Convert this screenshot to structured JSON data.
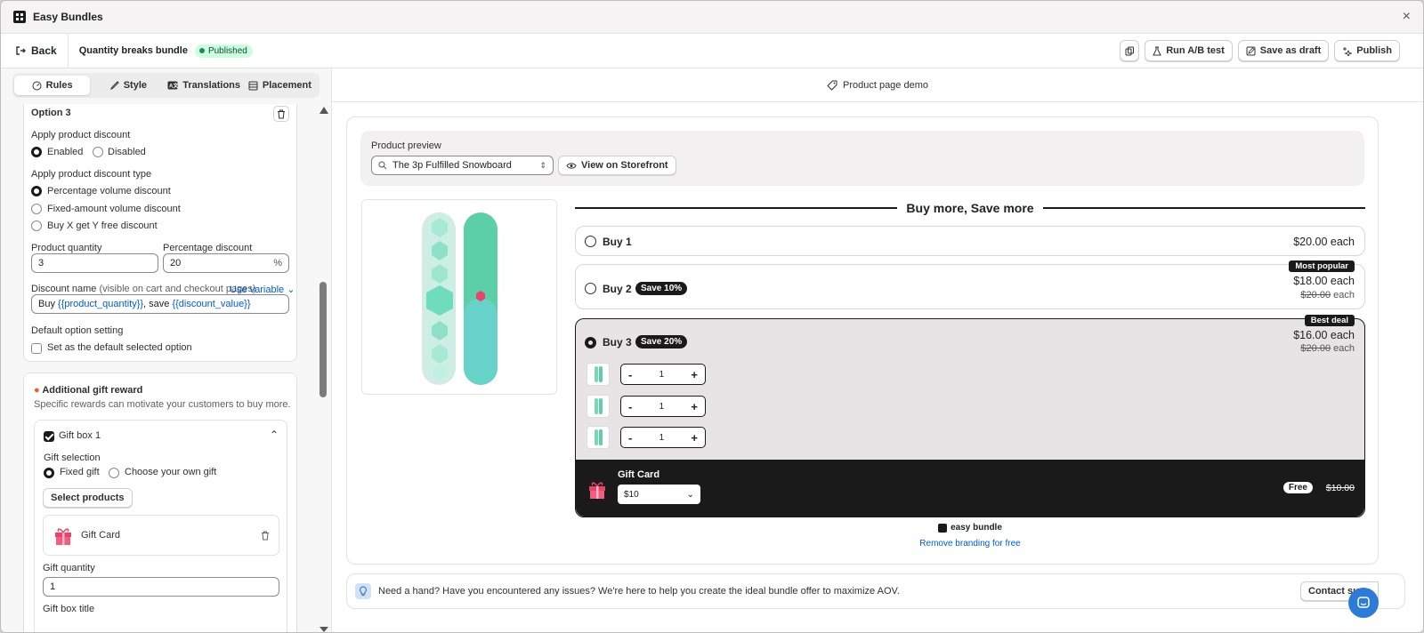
{
  "window": {
    "title": "Easy Bundles",
    "close": "×"
  },
  "header": {
    "back": "Back",
    "bundle_name": "Quantity breaks bundle",
    "status": "Published",
    "actions": {
      "ab_test": "Run A/B test",
      "save_draft": "Save as draft",
      "publish": "Publish"
    }
  },
  "tabs": [
    {
      "label": "Rules",
      "icon": "gauge-icon"
    },
    {
      "label": "Style",
      "icon": "brush-icon"
    },
    {
      "label": "Translations",
      "icon": "translate-icon"
    },
    {
      "label": "Placement",
      "icon": "layout-icon"
    }
  ],
  "option_card": {
    "title": "Option 3",
    "apply_discount_label": "Apply product discount",
    "apply_discount_options": [
      "Enabled",
      "Disabled"
    ],
    "apply_discount_selected": "Enabled",
    "discount_type_label": "Apply product discount type",
    "discount_types": [
      "Percentage volume discount",
      "Fixed-amount volume discount",
      "Buy X get Y free discount"
    ],
    "discount_type_selected": "Percentage volume discount",
    "quantity_label": "Product quantity",
    "quantity_value": "3",
    "percentage_label": "Percentage discount",
    "percentage_value": "20",
    "percentage_suffix": "%",
    "discount_name_label": "Discount name",
    "discount_name_hint": "(visible on cart and checkout pages)",
    "use_variable": "Use variable",
    "discount_name_prefix": "Buy ",
    "discount_name_var1": "{{product_quantity}}",
    "discount_name_mid": ", save ",
    "discount_name_var2": "{{discount_value}}",
    "default_setting_label": "Default option setting",
    "default_checkbox_label": "Set as the default selected option"
  },
  "gift_card_panel": {
    "title": "Additional gift reward",
    "subtitle": "Specific rewards can motivate your customers to buy more.",
    "giftbox_title": "Gift box 1",
    "gift_selection_label": "Gift selection",
    "gift_selection_options": [
      "Fixed gift",
      "Choose your own gift"
    ],
    "gift_selection_selected": "Fixed gift",
    "select_products": "Select products",
    "gift_item_name": "Gift Card",
    "gift_quantity_label": "Gift quantity",
    "gift_quantity_value": "1",
    "giftbox_title_label": "Gift box title"
  },
  "preview": {
    "header": "Product page demo",
    "product_preview_label": "Product preview",
    "product_selected": "The 3p Fulfilled Snowboard",
    "view_storefront": "View on Storefront",
    "section_title": "Buy more, Save more",
    "options": [
      {
        "name": "Buy 1",
        "price": "$20.00 each",
        "save": "",
        "strike": "",
        "ribbon": ""
      },
      {
        "name": "Buy 2",
        "price": "$18.00 each",
        "save": "Save 10%",
        "strike": "$20.00",
        "strike_suffix": " each",
        "ribbon": "Most popular"
      },
      {
        "name": "Buy 3",
        "price": "$16.00 each",
        "save": "Save 20%",
        "strike": "$20.00",
        "strike_suffix": " each",
        "ribbon": "Best deal"
      }
    ],
    "quantity_rows": [
      {
        "minus": "-",
        "value": "1",
        "plus": "+"
      },
      {
        "minus": "-",
        "value": "1",
        "plus": "+"
      },
      {
        "minus": "-",
        "value": "1",
        "plus": "+"
      }
    ],
    "gift": {
      "title": "Gift Card",
      "select_value": "$10",
      "free": "Free",
      "strike_price": "$10.00"
    },
    "branding": "easy bundle",
    "remove_branding": "Remove branding for free",
    "help_text": "Need a hand? Have you encountered any issues? We're here to help you create the ideal bundle offer to maximize AOV.",
    "contact": "Contact supp"
  },
  "colors": {
    "accent": "#1a1a1a",
    "link": "#005bd3",
    "published_bg": "#cdfee1",
    "selected_option_bg": "#e8e4e5",
    "chat": "#2d7bd6"
  }
}
